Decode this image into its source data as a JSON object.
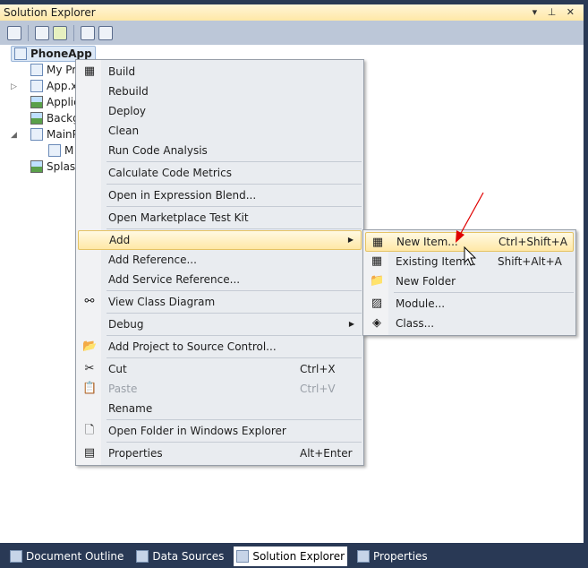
{
  "window": {
    "title": "Solution Explorer",
    "buttons": [
      "▾",
      "⊥",
      "✕"
    ]
  },
  "tree": {
    "root": "PhoneApp",
    "items": [
      "My Pr",
      "App.x",
      "Applic",
      "Backg",
      "MainP",
      "M",
      "Splash"
    ]
  },
  "context_menu": {
    "items": [
      {
        "label": "Build",
        "icon": "build-icon"
      },
      {
        "label": "Rebuild"
      },
      {
        "label": "Deploy"
      },
      {
        "label": "Clean"
      },
      {
        "label": "Run Code Analysis"
      },
      {
        "sep": true
      },
      {
        "label": "Calculate Code Metrics"
      },
      {
        "sep": true
      },
      {
        "label": "Open in Expression Blend..."
      },
      {
        "sep": true
      },
      {
        "label": "Open Marketplace Test Kit"
      },
      {
        "sep": true
      },
      {
        "label": "Add",
        "submenu": true,
        "highlighted": true
      },
      {
        "label": "Add Reference..."
      },
      {
        "label": "Add Service Reference..."
      },
      {
        "sep": true
      },
      {
        "label": "View Class Diagram",
        "icon": "class-diagram-icon"
      },
      {
        "sep": true
      },
      {
        "label": "Debug",
        "submenu": true
      },
      {
        "sep": true
      },
      {
        "label": "Add Project to Source Control...",
        "icon": "folder-add-icon"
      },
      {
        "sep": true
      },
      {
        "label": "Cut",
        "shortcut": "Ctrl+X",
        "icon": "scissors-icon"
      },
      {
        "label": "Paste",
        "shortcut": "Ctrl+V",
        "disabled": true,
        "icon": "paste-icon"
      },
      {
        "label": "Rename"
      },
      {
        "sep": true
      },
      {
        "label": "Open Folder in Windows Explorer",
        "icon": "open-folder-icon"
      },
      {
        "sep": true
      },
      {
        "label": "Properties",
        "shortcut": "Alt+Enter",
        "icon": "properties-icon"
      }
    ]
  },
  "add_submenu": {
    "items": [
      {
        "label": "New Item...",
        "shortcut": "Ctrl+Shift+A",
        "highlighted": true,
        "icon": "new-item-icon"
      },
      {
        "label": "Existing Item...",
        "shortcut": "Shift+Alt+A",
        "icon": "existing-item-icon"
      },
      {
        "label": "New Folder",
        "icon": "new-folder-icon"
      },
      {
        "sep": true
      },
      {
        "label": "Module...",
        "icon": "module-icon"
      },
      {
        "label": "Class...",
        "icon": "class-icon"
      }
    ]
  },
  "bottom_tabs": [
    {
      "label": "Document Outline"
    },
    {
      "label": "Data Sources"
    },
    {
      "label": "Solution Explorer",
      "active": true
    },
    {
      "label": "Properties"
    }
  ],
  "colors": {
    "frame": "#293955",
    "highlight": "#ffe8a6",
    "annotation_arrow": "#e00000"
  }
}
